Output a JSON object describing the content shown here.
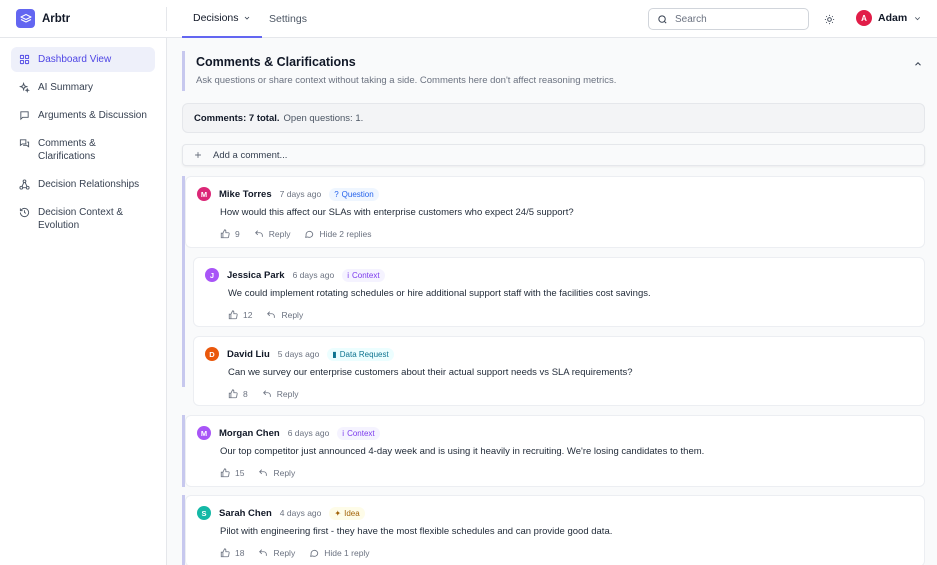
{
  "app": {
    "name": "Arbtr"
  },
  "nav": {
    "tabs": [
      {
        "label": "Decisions"
      },
      {
        "label": "Settings"
      }
    ]
  },
  "search": {
    "placeholder": "Search"
  },
  "user": {
    "initial": "A",
    "name": "Adam"
  },
  "sidebar": {
    "items": [
      {
        "label": "Dashboard View",
        "icon": "grid-icon"
      },
      {
        "label": "AI Summary",
        "icon": "sparkle-icon"
      },
      {
        "label": "Arguments & Discussion",
        "icon": "chat-icon"
      },
      {
        "label": "Comments & Clarifications",
        "icon": "chats-icon"
      },
      {
        "label": "Decision Relationships",
        "icon": "network-icon"
      },
      {
        "label": "Decision Context & Evolution",
        "icon": "history-icon"
      }
    ]
  },
  "section": {
    "title": "Comments & Clarifications",
    "subtitle": "Ask questions or share context without taking a side. Comments here don't affect reasoning metrics."
  },
  "summary": {
    "count_label": "Comments: 7 total.",
    "open_label": "Open questions: 1."
  },
  "add_comment": {
    "label": "Add a comment..."
  },
  "colors": {
    "accent": "#6366f1",
    "thread_border": "#c7c8ee"
  },
  "comments": [
    {
      "initial": "M",
      "name": "Mike Torres",
      "time": "7 days ago",
      "badge": "Question",
      "badge_icon": "?",
      "text": "How would this affect our SLAs with enterprise customers who expect 24/5 support?",
      "likes": "9",
      "reply": "Reply",
      "toggle": "Hide 2 replies",
      "color": "#db2777"
    },
    {
      "initial": "J",
      "name": "Jessica Park",
      "time": "6 days ago",
      "badge": "Context",
      "badge_icon": "i",
      "text": "We could implement rotating schedules or hire additional support staff with the facilities cost savings.",
      "likes": "12",
      "reply": "Reply",
      "color": "#a855f7"
    },
    {
      "initial": "D",
      "name": "David Liu",
      "time": "5 days ago",
      "badge": "Data Request",
      "badge_icon": "▮",
      "text": "Can we survey our enterprise customers about their actual support needs vs SLA requirements?",
      "likes": "8",
      "reply": "Reply",
      "color": "#ea580c"
    },
    {
      "initial": "M",
      "name": "Morgan Chen",
      "time": "6 days ago",
      "badge": "Context",
      "badge_icon": "i",
      "text": "Our top competitor just announced 4-day week and is using it heavily in recruiting. We're losing candidates to them.",
      "likes": "15",
      "reply": "Reply",
      "color": "#a855f7"
    },
    {
      "initial": "S",
      "name": "Sarah Chen",
      "time": "4 days ago",
      "badge": "Idea",
      "badge_icon": "✦",
      "text": "Pilot with engineering first - they have the most flexible schedules and can provide good data.",
      "likes": "18",
      "reply": "Reply",
      "toggle": "Hide 1 reply",
      "color": "#14b8a6"
    }
  ]
}
